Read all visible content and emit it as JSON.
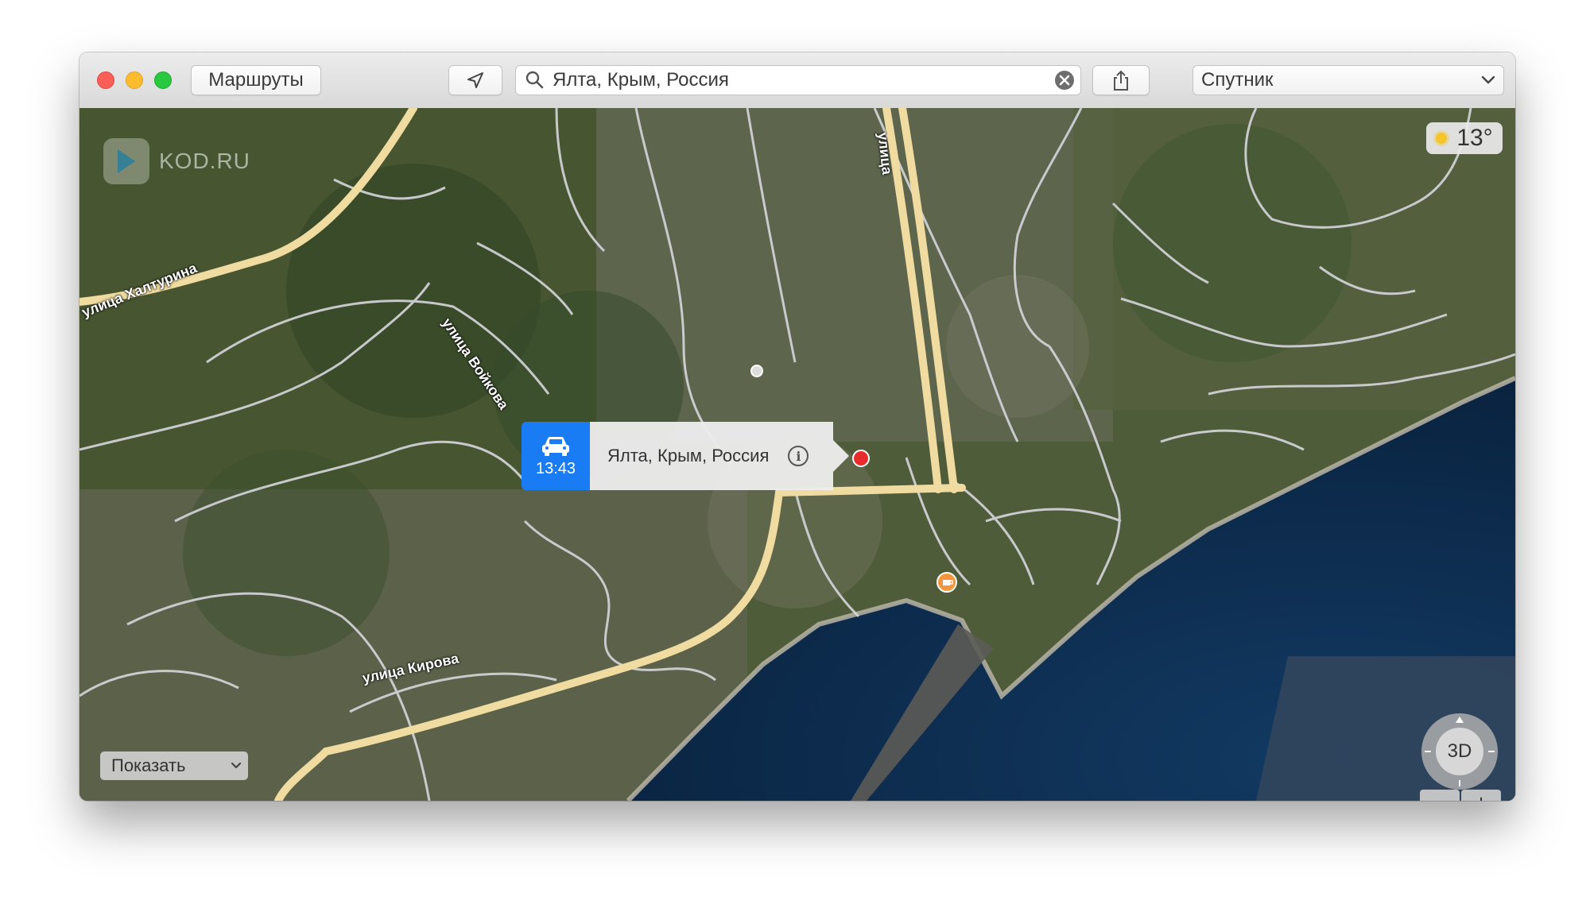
{
  "toolbar": {
    "directions_label": "Маршруты",
    "search_value": "Ялта, Крым, Россия",
    "map_type": "Спутник"
  },
  "map": {
    "weather": "13°",
    "watermark": "KOD.RU",
    "callout": {
      "eta": "13:43",
      "title": "Ялта, Крым, Россия"
    },
    "streets": {
      "khalturina": "улица Халтурина",
      "voykova": "улица Войкова",
      "kirova": "улица Кирова",
      "ulitsa": "улица"
    },
    "show_label": "Показать",
    "view_3d": "3D",
    "zoom_out": "−",
    "zoom_in": "+"
  },
  "colors": {
    "accent": "#1a7cf5",
    "pin": "#ea2b2b",
    "poi": "#f6953a",
    "major_road": "#f2dc9e",
    "sea": "#0c2945"
  }
}
